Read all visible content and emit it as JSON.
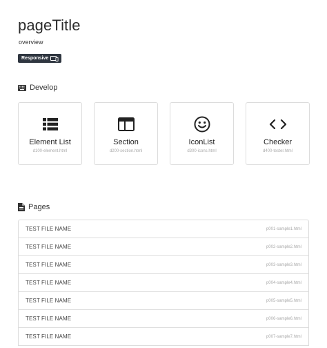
{
  "header": {
    "title": "pageTitle",
    "subtitle": "overview",
    "badge_label": "Responsive",
    "badge_icon": "devices-icon"
  },
  "develop": {
    "heading": "Develop",
    "heading_icon": "keyboard-icon",
    "cards": [
      {
        "name": "Element List",
        "file": "d100-element.html",
        "icon": "list-icon"
      },
      {
        "name": "Section",
        "file": "d200-section.html",
        "icon": "window-icon"
      },
      {
        "name": "IconList",
        "file": "d300-icons.html",
        "icon": "smiley-icon"
      },
      {
        "name": "Checker",
        "file": "d400-tester.html",
        "icon": "code-icon"
      }
    ]
  },
  "pages": {
    "heading": "Pages",
    "heading_icon": "file-icon",
    "rows": [
      {
        "name": "TEST FILE NAME",
        "file": "p001-sample1.html"
      },
      {
        "name": "TEST FILE NAME",
        "file": "p002-sample2.html"
      },
      {
        "name": "TEST FILE NAME",
        "file": "p003-sample3.html"
      },
      {
        "name": "TEST FILE NAME",
        "file": "p004-sample4.html"
      },
      {
        "name": "TEST FILE NAME",
        "file": "p005-sample5.html"
      },
      {
        "name": "TEST FILE NAME",
        "file": "p006-sample6.html"
      },
      {
        "name": "TEST FILE NAME",
        "file": "p007-sample7.html"
      }
    ]
  },
  "colors": {
    "badge_bg": "#2f3640",
    "border": "#dcdcdc",
    "muted_text": "#aaaaaa"
  }
}
